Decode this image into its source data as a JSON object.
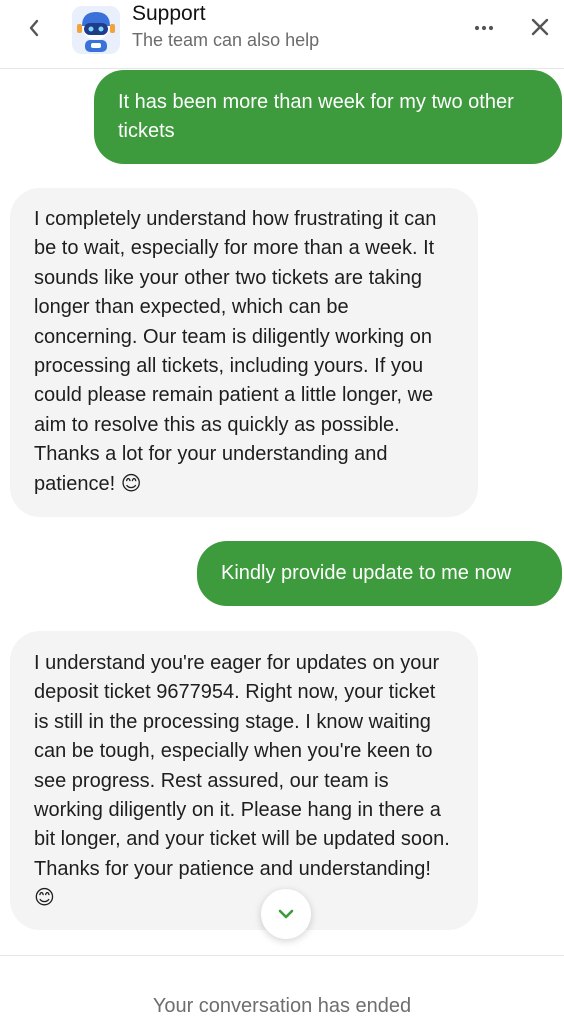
{
  "header": {
    "title": "Support",
    "subtitle": "The team can also help",
    "icons": [
      "back-chevron-icon",
      "bot-avatar",
      "more-dots-icon",
      "close-icon"
    ]
  },
  "messages": [
    {
      "sender": "user",
      "text": "It has been more than week for my two other tickets"
    },
    {
      "sender": "bot",
      "text": "I completely understand how frustrating it can be to wait, especially for more than a week. It sounds like your other two tickets are taking longer than expected, which can be concerning. Our team is diligently working on processing all tickets, including yours. If you could please remain patient a little longer, we aim to resolve this as quickly as possible. Thanks a lot for your understanding and patience! 😊"
    },
    {
      "sender": "user",
      "text": "Kindly provide update to me now"
    },
    {
      "sender": "bot",
      "text": "I understand you're eager for updates on your deposit ticket 9677954. Right now, your ticket is still in the processing stage. I know waiting can be tough, especially when you're keen to see progress. Rest assured, our team is working diligently on it. Please hang in there a bit longer, and your ticket will be updated soon. Thanks for your patience and understanding! 😊"
    }
  ],
  "footer": {
    "status": "Your conversation has ended"
  },
  "colors": {
    "user_bubble": "#3d9a3d",
    "bot_bubble": "#f4f4f4"
  }
}
